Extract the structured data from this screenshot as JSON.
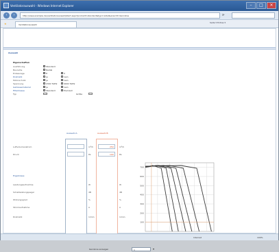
{
  "window": {
    "title": "Ventilatorauswahl - Windows Internet Explorer"
  },
  "address": {
    "url": "http://www.example.de/ventilatorauswahl/start.aspx?produkt=standard&typ=radial&ansicht=kennlinie"
  },
  "tabs": [
    {
      "label": "Ventilatorauswahl"
    }
  ],
  "toolbar": {
    "label": "Seite ▾  Extras ▾"
  },
  "page": {
    "title": "Auswahl"
  },
  "properties": {
    "section_title": "Eigenschaften",
    "rows": [
      {
        "label": "Ausführung",
        "options": [
          "Standard"
        ]
      },
      {
        "label": "Baureihe",
        "options": [
          "Radial"
        ]
      },
      {
        "label": "Einbaulage",
        "options": [
          "H",
          "V"
        ]
      },
      {
        "label": "Drehzahl",
        "options": [
          "ja",
          "nein"
        ]
      },
      {
        "label": "Motorschutz",
        "options": [
          "ja",
          "nein"
        ]
      },
      {
        "label": "Spannung",
        "options": [
          "230V 50Hz",
          "400V 50Hz"
        ]
      },
      {
        "label": "Gehäusematerial",
        "options": [
          "ja",
          "nein"
        ]
      },
      {
        "label": "Filterklasse",
        "options": [
          "Standard",
          "Premium"
        ]
      }
    ],
    "bottom_left": "Typ",
    "bottom_right": "Größe"
  },
  "columns": {
    "a": "Auswahl A",
    "b": "Auswahl B"
  },
  "fields": [
    {
      "label": "Luftvolumenstrom",
      "unit": "m³/h",
      "a": "",
      "b": "250"
    },
    {
      "label": "Druck",
      "unit": "Pa",
      "a": "",
      "b": "100"
    }
  ],
  "results": {
    "section_title": "Ergebnisse",
    "rows": [
      {
        "label": "Leistungsaufnahme",
        "unit_a": "W",
        "unit_b": "W"
      },
      {
        "label": "Schallleistungspegel",
        "unit_a": "dB",
        "unit_b": "dB"
      },
      {
        "label": "Wirkungsgrad",
        "unit_a": "%",
        "unit_b": "%"
      },
      {
        "label": "Stromaufnahme",
        "unit_a": "A",
        "unit_b": "A"
      },
      {
        "label": "Drehzahl",
        "unit_a": "1/min",
        "unit_b": "1/min"
      }
    ]
  },
  "control": {
    "label": "Kennlinie anzeigen",
    "value": "1"
  },
  "chart_data": {
    "type": "line",
    "y_ticks": [
      "700",
      "600",
      "500",
      "400",
      "300",
      "200",
      "100"
    ],
    "x_ticks": [
      "500",
      "1000",
      "1500",
      "2000",
      "2500"
    ],
    "series": [
      {
        "x": [
          0,
          300,
          650,
          1100
        ],
        "y": [
          700,
          720,
          690,
          0
        ]
      },
      {
        "x": [
          0,
          450,
          850,
          1350
        ],
        "y": [
          700,
          720,
          690,
          0
        ]
      },
      {
        "x": [
          0,
          550,
          1050,
          1650
        ],
        "y": [
          710,
          720,
          690,
          0
        ]
      },
      {
        "x": [
          0,
          750,
          1250,
          1900
        ],
        "y": [
          710,
          720,
          690,
          0
        ]
      },
      {
        "x": [
          0,
          1000,
          1550,
          2200
        ],
        "y": [
          710,
          720,
          690,
          0
        ]
      },
      {
        "x": [
          0,
          1450,
          2100,
          2700
        ],
        "y": [
          710,
          720,
          690,
          0
        ]
      }
    ],
    "xlim": [
      0,
      2800
    ],
    "ylim": [
      0,
      750
    ]
  },
  "status": {
    "zone": "Internet",
    "zoom": "100%"
  }
}
